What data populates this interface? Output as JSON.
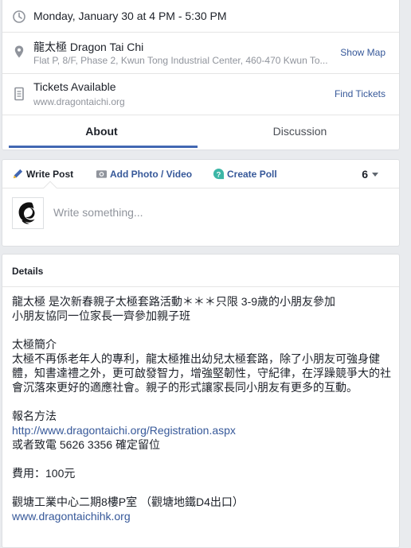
{
  "event": {
    "time": "Monday, January 30 at 4 PM - 5:30 PM",
    "location_name": "龍太極 Dragon Tai Chi",
    "location_address": "Flat P, 8/F, Phase 2, Kwun Tong Industrial Center, 460-470 Kwun To...",
    "show_map": "Show Map",
    "tickets_title": "Tickets Available",
    "tickets_url": "www.dragontaichi.org",
    "find_tickets": "Find Tickets"
  },
  "tabs": {
    "about": "About",
    "discussion": "Discussion"
  },
  "composer": {
    "write_post": "Write Post",
    "add_photo": "Add Photo / Video",
    "create_poll": "Create Poll",
    "page_glyph": "6",
    "placeholder": "Write something..."
  },
  "details": {
    "title": "Details",
    "intro_line1": "龍太極 是次新春親子太極套路活動＊＊＊只限 3-9歲的小朋友參加",
    "intro_line2": "小朋友協同一位家長一齊參加親子班",
    "summary_heading": "太極簡介",
    "summary_text": "太極不再係老年人的專利，龍太極推出幼兒太極套路，除了小朋友可強身健體，知書達禮之外，更可啟發智力，增強堅韌性，守紀律，在浮躁競爭大的社會沉落來更好的適應社會。親子的形式讓家長同小朋友有更多的互動。",
    "registration_heading": "報名方法",
    "registration_link": "http://www.dragontaichi.org/Registration.aspx",
    "registration_phone": "或者致電 5626 3356 確定留位",
    "fee": "費用：100元",
    "address": "觀塘工業中心二期8樓P室 （觀塘地鐵D4出口）",
    "website_link": "www.dragontaichihk.org"
  },
  "colors": {
    "link": "#365899",
    "tab_underline": "#4267b2",
    "poll_icon": "#3cb6a6",
    "background": "#e9ebee"
  }
}
